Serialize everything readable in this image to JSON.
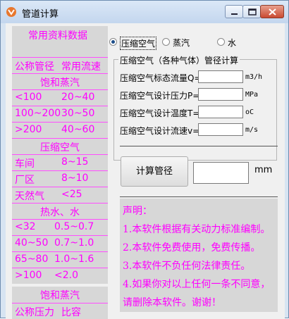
{
  "window": {
    "title": "管道计算"
  },
  "left_panel": {
    "heading": "常用资料数据",
    "header": {
      "left": "公称管径",
      "right": "常用流速"
    },
    "sections": [
      {
        "title": "饱和蒸汽",
        "rows": [
          [
            "<100",
            "20~40"
          ],
          [
            "100~200",
            "30~50"
          ],
          [
            ">200",
            "40~60"
          ]
        ]
      },
      {
        "title": "压缩空气",
        "rows": [
          [
            "车间",
            "8~15"
          ],
          [
            "厂区",
            "8~10"
          ],
          [
            "天然气",
            "<25"
          ]
        ]
      },
      {
        "title": "热水、水",
        "rows": [
          [
            "<32",
            "0.5~0.7"
          ],
          [
            "40~50",
            "0.7~1.0"
          ],
          [
            "65~80",
            "1.0~1.6"
          ],
          [
            ">100",
            "<2.0"
          ]
        ]
      }
    ],
    "section2": {
      "title": "饱和蒸汽",
      "header": {
        "left": "公称压力",
        "right": "比容"
      }
    }
  },
  "media": {
    "options": [
      "压缩空气",
      "蒸汽",
      "水"
    ],
    "selected": "压缩空气"
  },
  "calc": {
    "group_title": "压缩空气（各种气体）管径计算",
    "fields": [
      {
        "label": "压缩空气标态流量Q=",
        "unit": "m3/h",
        "value": ""
      },
      {
        "label": "压缩空气设计压力P=",
        "unit": "MPa",
        "value": ""
      },
      {
        "label": "压缩空气设计温度T=",
        "unit": "oC",
        "value": ""
      },
      {
        "label": "压缩空气设计流速v=",
        "unit": "m/s",
        "value": ""
      }
    ],
    "button_label": "计算管径",
    "result_value": "",
    "result_unit": "mm"
  },
  "notes": [
    "声明：",
    "1.本软件根据有关动力标准编制。",
    "2.本软件免费使用，免费传播。",
    "3.本软件不负任何法律责任。",
    "4.如果你对以上任何一条不同意，",
    "请删除本软件。谢谢！"
  ],
  "colors": {
    "note_text": "#ff00ff",
    "panel_bg": "#d7d7d7"
  }
}
